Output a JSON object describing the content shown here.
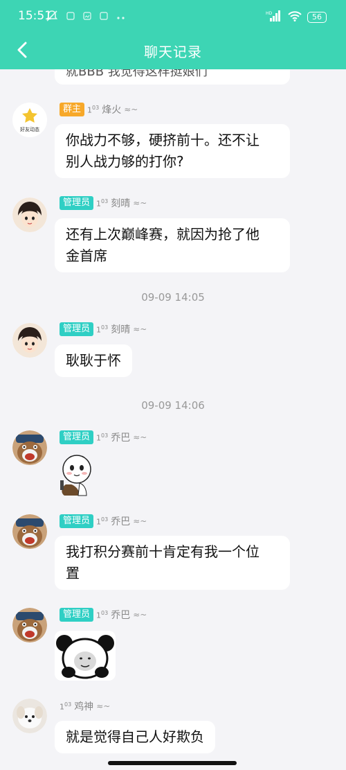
{
  "status_bar": {
    "time": "15:51",
    "network_label": "HD",
    "battery": "56"
  },
  "header": {
    "title": "聊天记录"
  },
  "messages": [
    {
      "text": "就BBB 我觉得这样挺娘们"
    },
    {
      "avatar_label": "好友动态",
      "badge": "群主",
      "level": "1",
      "level_sup": "0",
      "level_tail": "3",
      "name": "烽火",
      "text_line1": "你战力不够，硬挤前十。还不让",
      "text_line2": "别人战力够的打你?"
    },
    {
      "badge": "管理员",
      "level": "1",
      "level_sup": "0",
      "level_tail": "3",
      "name": "刻晴",
      "text_line1": "还有上次巅峰赛，就因为抢了他",
      "text_line2": "金首席"
    },
    {
      "timestamp": "09-09 14:05"
    },
    {
      "badge": "管理员",
      "level": "1",
      "level_sup": "0",
      "level_tail": "3",
      "name": "刻晴",
      "text": "耿耿于怀"
    },
    {
      "timestamp": "09-09 14:06"
    },
    {
      "badge": "管理员",
      "level": "1",
      "level_sup": "0",
      "level_tail": "3",
      "name": "乔巴"
    },
    {
      "badge": "管理员",
      "level": "1",
      "level_sup": "0",
      "level_tail": "3",
      "name": "乔巴",
      "text_line1": "我打积分赛前十肯定有我一个位",
      "text_line2": "置"
    },
    {
      "badge": "管理员",
      "level": "1",
      "level_sup": "0",
      "level_tail": "3",
      "name": "乔巴"
    },
    {
      "level": "1",
      "level_sup": "0",
      "level_tail": "3",
      "name": "鸡神",
      "text": "就是觉得自己人好欺负"
    }
  ],
  "colors": {
    "brand": "#3dd5b4",
    "owner_badge": "#f7a829",
    "admin_badge": "#2fcfc4",
    "background": "#f4f4f7"
  }
}
